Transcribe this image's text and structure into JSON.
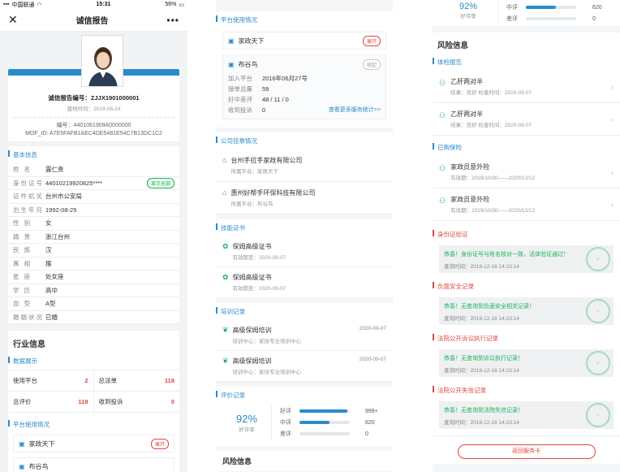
{
  "status_bar": {
    "carrier": "中国联通",
    "time": "15:31",
    "battery": "56%"
  },
  "nav": {
    "title": "诚信报告"
  },
  "profile": {
    "report_no": "诚信报告编号：ZJJX1901000001",
    "created": "建档时间：2019-08-24",
    "code": "编号：4401061909A0000000",
    "mof": "MOF_ID:  A7E5FAFB1AEC4DE5481E54C7B13DC1C2"
  },
  "basic": {
    "title": "基本信息",
    "show_all": "显示全部",
    "rows": [
      {
        "k": "姓 名",
        "v": "露仁贵"
      },
      {
        "k": "身份证号",
        "v": "44010219920825****"
      },
      {
        "k": "证件机关",
        "v": "台州市公安局"
      },
      {
        "k": "出生年月",
        "v": "1992-08-25"
      },
      {
        "k": "性 别",
        "v": "女"
      },
      {
        "k": "籍 贯",
        "v": "浙江台州"
      },
      {
        "k": "民 族",
        "v": "汉"
      },
      {
        "k": "属 相",
        "v": "猴"
      },
      {
        "k": "星 座",
        "v": "处女座"
      },
      {
        "k": "学 历",
        "v": "高中"
      },
      {
        "k": "血 型",
        "v": "A型"
      },
      {
        "k": "婚姻状况",
        "v": "已婚"
      }
    ]
  },
  "industry": {
    "title": "行业信息",
    "data_title": "数据展示",
    "cells": [
      {
        "k": "使用平台",
        "v": "2"
      },
      {
        "k": "总派单",
        "v": "118"
      },
      {
        "k": "总评价",
        "v": "118"
      },
      {
        "k": "收到投诉",
        "v": "0"
      }
    ],
    "platform_title": "平台使用情况",
    "p1": "家政天下",
    "open": "展开",
    "p2_partial": "布谷鸟"
  },
  "platform": {
    "title": "平台使用情况",
    "p1": "家政天下",
    "open": "展开",
    "p2": "布谷鸟",
    "close": "收起",
    "rows": [
      {
        "k": "加入平台",
        "v": "2016年06月27号"
      },
      {
        "k": "接单总量",
        "v": "59"
      },
      {
        "k": "好中差评",
        "v": "48 / 11 / 0"
      },
      {
        "k": "收到投诉",
        "v": "0"
      }
    ],
    "more": "查看更多服务统计>>"
  },
  "company": {
    "title": "公司挂靠情况",
    "items": [
      {
        "name": "台州手拉手家政有限公司",
        "sub": "所属平台：家政天下"
      },
      {
        "name": "惠州好帮手环保科技有限公司",
        "sub": "所属平台：布谷鸟"
      }
    ]
  },
  "certs": {
    "title": "技能证书",
    "items": [
      {
        "name": "保姆高级证书",
        "sub": "有效期至：2020-09-07"
      },
      {
        "name": "保姆高级证书",
        "sub": "有效期至：2020-09-07"
      }
    ]
  },
  "training": {
    "title": "培训记录",
    "items": [
      {
        "name": "高级保姆培训",
        "sub": "培训中心：家协专业培训中心",
        "date": "2020-09-07"
      },
      {
        "name": "高级保姆培训",
        "sub": "培训中心：家协专业培训中心",
        "date": "2020-09-07"
      }
    ]
  },
  "rating": {
    "title": "评价记录",
    "pct": "92%",
    "pct_label": "好评率",
    "bars": [
      {
        "k": "好评",
        "v": "999+",
        "frac": 0.95
      },
      {
        "k": "中评",
        "v": "620",
        "frac": 0.6
      },
      {
        "k": "差评",
        "v": "0",
        "frac": 0
      }
    ]
  },
  "risk_partial": "风险信息",
  "c3_top": {
    "pct": "92%",
    "pct_label": "好评率",
    "rows": [
      {
        "k": "中评",
        "v": "620",
        "frac": 0.6
      },
      {
        "k": "差评",
        "v": "0",
        "frac": 0
      }
    ]
  },
  "risk": {
    "title": "风险信息",
    "health": {
      "title": "体检报告",
      "items": [
        {
          "name": "乙肝两对半",
          "sub": "结果：良好    检查时间：2020-09-07"
        },
        {
          "name": "乙肝两对半",
          "sub": "结果：良好    检查时间：2020-09-07"
        }
      ]
    },
    "insurance": {
      "title": "已购保险",
      "items": [
        {
          "name": "家政员意外险",
          "sub": "有效期：2019/10/30——2020/12/12"
        },
        {
          "name": "家政员意外险",
          "sub": "有效期：2019/10/30——2020/12/12"
        }
      ]
    },
    "checks": [
      {
        "title": "身份证验证",
        "msg": "恭喜！身份证号与姓名核对一致，活体验证通过！",
        "time": "查询时间：2019-12-16 14:23:14"
      },
      {
        "title": "负面安全记录",
        "msg": "恭喜！无查询到负面安全相关记录！",
        "time": "查询时间：2019-12-16 14:23:14"
      },
      {
        "title": "法院公开诉讼执行记录",
        "msg": "恭喜！无查询到诉讼执行记录！",
        "time": "查询时间：2019-12-16 14:23:14"
      },
      {
        "title": "法院公开失信记录",
        "msg": "恭喜！无查询到法院失信记录！",
        "time": "查询时间：2019-12-16 14:23:14"
      }
    ],
    "back": "返回服务卡"
  }
}
